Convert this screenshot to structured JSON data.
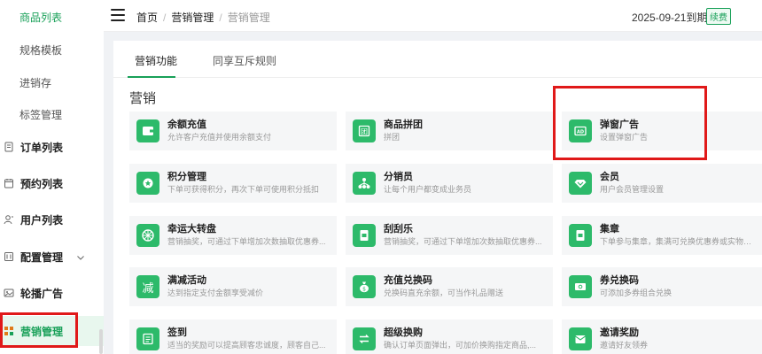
{
  "sidebar": {
    "items": [
      {
        "label": "商品列表",
        "type": "sub",
        "active": true
      },
      {
        "label": "规格模板",
        "type": "sub"
      },
      {
        "label": "进销存",
        "type": "sub"
      },
      {
        "label": "标签管理",
        "type": "sub"
      },
      {
        "label": "订单列表",
        "type": "top",
        "icon": "document-icon"
      },
      {
        "label": "预约列表",
        "type": "top",
        "icon": "calendar-icon"
      },
      {
        "label": "用户列表",
        "type": "top",
        "icon": "user-icon"
      },
      {
        "label": "配置管理",
        "type": "top",
        "icon": "settings-icon"
      },
      {
        "label": "轮播广告",
        "type": "top",
        "icon": "image-icon"
      },
      {
        "label": "营销管理",
        "type": "top",
        "icon": "grid-icon",
        "active": true
      }
    ]
  },
  "header": {
    "breadcrumb": [
      "首页",
      "营销管理",
      "营销管理"
    ],
    "expire_text": "2025-09-21到期",
    "renew_label": "续费"
  },
  "tabs": [
    {
      "label": "营销功能",
      "active": true
    },
    {
      "label": "同享互斥规则"
    }
  ],
  "section_title": "营销",
  "cards": [
    {
      "title": "余额充值",
      "desc": "允许客户充值并使用余额支付",
      "icon": "wallet-icon"
    },
    {
      "title": "商品拼团",
      "desc": "拼团",
      "icon": "group-icon"
    },
    {
      "title": "弹窗广告",
      "desc": "设置弹窗广告",
      "icon": "ad-icon"
    },
    {
      "title": "积分管理",
      "desc": "下单可获得积分，再次下单可使用积分抵扣",
      "icon": "points-icon"
    },
    {
      "title": "分销员",
      "desc": "让每个用户都变成业务员",
      "icon": "distribution-icon"
    },
    {
      "title": "会员",
      "desc": "用户会员管理设置",
      "icon": "diamond-icon"
    },
    {
      "title": "幸运大转盘",
      "desc": "营销抽奖，可通过下单增加次数抽取优惠券...",
      "icon": "wheel-icon"
    },
    {
      "title": "刮刮乐",
      "desc": "营销抽奖，可通过下单增加次数抽取优惠券...",
      "icon": "scratch-icon"
    },
    {
      "title": "集章",
      "desc": "下单参与集章，集满可兑换优惠券或实物奖品",
      "icon": "stamp-icon"
    },
    {
      "title": "满减活动",
      "desc": "达到指定支付金额享受减价",
      "icon": "discount-icon",
      "glyph": "减"
    },
    {
      "title": "充值兑换码",
      "desc": "兑换码直充余额，可当作礼品赠送",
      "icon": "moneybag-icon"
    },
    {
      "title": "券兑换码",
      "desc": "可添加多券组合兑换",
      "icon": "coupon-icon"
    },
    {
      "title": "签到",
      "desc": "适当的奖励可以提高顾客忠诚度，顾客自己...",
      "icon": "checkin-icon"
    },
    {
      "title": "超级换购",
      "desc": "确认订单页面弹出，可加价换购指定商品,...",
      "icon": "exchange-icon"
    },
    {
      "title": "邀请奖励",
      "desc": "邀请好友领券",
      "icon": "invite-icon"
    }
  ],
  "colors": {
    "accent": "#18a058",
    "icon_bg": "#2dba6a",
    "highlight": "#e01919"
  }
}
